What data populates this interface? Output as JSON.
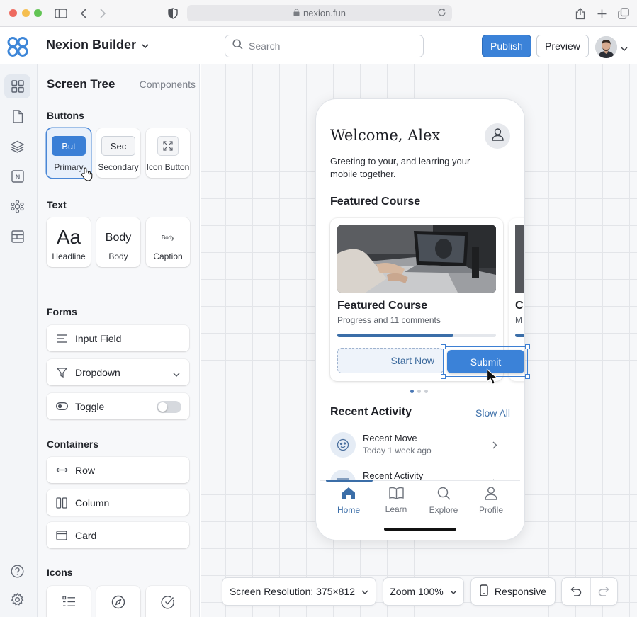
{
  "browser": {
    "url": "nexion.fun"
  },
  "header": {
    "app_title": "Nexion Builder",
    "search_placeholder": "Search",
    "publish_label": "Publish",
    "preview_label": "Preview"
  },
  "rail": {
    "icons": [
      "grid-icon",
      "page-icon",
      "layers-icon",
      "notion-icon",
      "plugin-icon",
      "layout-icon",
      "help-icon",
      "gear-icon"
    ]
  },
  "panel": {
    "tab_active": "Screen Tree",
    "tab_inactive": "Components",
    "buttons": {
      "title": "Buttons",
      "primary_mini": "But",
      "primary_cap": "Primary",
      "secondary_mini": "Sec",
      "secondary_cap": "Secondary",
      "icon_cap": "Icon Button"
    },
    "text": {
      "title": "Text",
      "headline_mini": "Aa",
      "headline_cap": "Headline",
      "body_mini": "Body",
      "body_cap": "Body",
      "caption_mini": "Body",
      "caption_cap": "Caption"
    },
    "forms": {
      "title": "Forms",
      "input": "Input Field",
      "dropdown": "Dropdown",
      "toggle": "Toggle"
    },
    "containers": {
      "title": "Containers",
      "row": "Row",
      "column": "Column",
      "card": "Card"
    },
    "icons": {
      "title": "Icons"
    }
  },
  "phone": {
    "welcome": "Welcome, Alex",
    "greeting": "Greeting to your, and learring your mobile together.",
    "featured_heading": "Featured Course",
    "card": {
      "title": "Featured Course",
      "subtitle": "Progress and 11 comments",
      "progress": 0.73,
      "start_label": "Start Now",
      "submit_label": "Submit"
    },
    "peek": {
      "title": "C",
      "sub": "M"
    },
    "recent_heading": "Recent Activity",
    "see_all": "Slow All",
    "activities": [
      {
        "title": "Recent Move",
        "sub": "Today 1 week ago"
      },
      {
        "title": "Recent Activity",
        "sub": ""
      }
    ],
    "tabs": [
      {
        "label": "Home",
        "icon": "home-icon"
      },
      {
        "label": "Learn",
        "icon": "book-icon"
      },
      {
        "label": "Explore",
        "icon": "search-icon"
      },
      {
        "label": "Profile",
        "icon": "person-icon"
      }
    ]
  },
  "toolbar": {
    "resolution": "Screen Resolution: 375×812",
    "zoom": "Zoom 100%",
    "responsive": "Responsive"
  },
  "colors": {
    "accent": "#3b82d8",
    "brand": "#3b6ea8"
  }
}
